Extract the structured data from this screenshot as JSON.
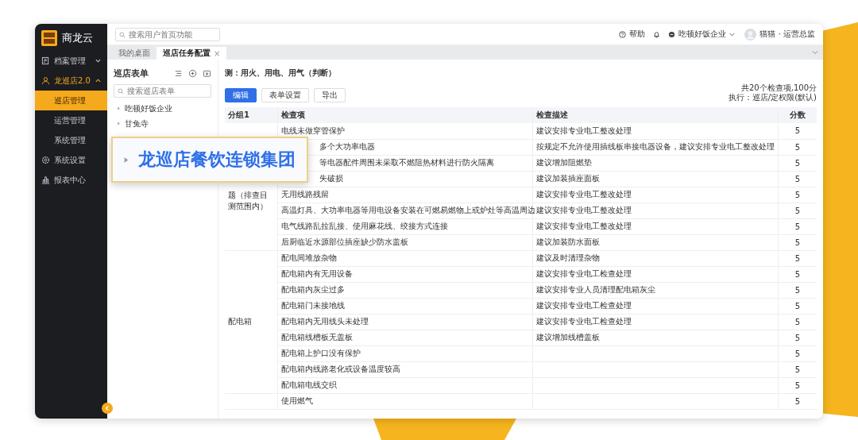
{
  "sidebar": {
    "brand": "商龙云",
    "items": [
      {
        "label": "档案管理",
        "kind": "group",
        "expanded": false
      },
      {
        "label": "龙巡店2.0",
        "kind": "group",
        "expanded": true,
        "children": [
          {
            "label": "巡店管理",
            "selected": true
          },
          {
            "label": "运营管理",
            "selected": false
          },
          {
            "label": "系统管理",
            "selected": false
          }
        ]
      },
      {
        "label": "系统设置",
        "kind": "link"
      },
      {
        "label": "报表中心",
        "kind": "link"
      }
    ]
  },
  "topbar": {
    "search_placeholder": "搜索用户首页功能",
    "help": "帮助",
    "company": "吃顿好饭企业",
    "user": "猫猫 · 运营总监"
  },
  "tabs": [
    {
      "label": "我的桌面",
      "selected": false
    },
    {
      "label": "巡店任务配置",
      "selected": true,
      "close": "×"
    }
  ],
  "left_panel": {
    "title": "巡店表单",
    "search_placeholder": "搜索巡店表单",
    "tree": [
      {
        "label": "吃顿好饭企业",
        "expanded": false
      },
      {
        "label": "甘兔寺",
        "expanded": false
      }
    ]
  },
  "callout": {
    "label": "龙巡店餐饮连锁集团"
  },
  "form": {
    "title": "测：用火、用电、用气（判断）",
    "buttons": [
      {
        "label": "编辑",
        "kind": "primary"
      },
      {
        "label": "表单设置",
        "kind": "default"
      },
      {
        "label": "导出",
        "kind": "default"
      }
    ],
    "summary": [
      "共20个检查项,100分",
      "执行：巡店/定权限(默认)"
    ],
    "table": {
      "columns": [
        "分组1",
        "检查项",
        "检查描述",
        "分数"
      ],
      "groups": [
        {
          "name": "题（排查目测范围内）",
          "rows": [
            {
              "item": "电线未做穿管保护",
              "description": "建议安排专业电工整改处理",
              "score": "5",
              "covered": false
            },
            {
              "item": "多个大功率电器",
              "description": "按规定不允许使用插线板串接电器设备，建议安排专业电工整改处理",
              "score": "5",
              "covered": true
            },
            {
              "item": "等电器配件周围未采取不燃阻热材料进行防火隔离",
              "description": "建议增加阻燃垫",
              "score": "5",
              "covered": true
            },
            {
              "item": "失破损",
              "description": "建议加装插座面板",
              "score": "5",
              "covered": true
            },
            {
              "item": "无用线路残留",
              "description": "建议安排专业电工整改处理",
              "score": "5",
              "covered": false
            },
            {
              "item": "高温灯具、大功率电器等用电设备安装在可燃易燃物上或炉灶等高温周边",
              "description": "建议安排专业电工整改处理",
              "score": "5",
              "covered": false
            },
            {
              "item": "电气线路乱拉乱接、使用麻花线、绞接方式连接",
              "description": "建议安排专业电工整改处理",
              "score": "5",
              "covered": false
            },
            {
              "item": "后厨临近水源部位插座缺少防水盖板",
              "description": "建议加装防水面板",
              "score": "5",
              "covered": false
            }
          ]
        },
        {
          "name": "配电箱",
          "rows": [
            {
              "item": "配电间堆放杂物",
              "description": "建议及时清理杂物",
              "score": "5",
              "covered": false
            },
            {
              "item": "配电箱内有无用设备",
              "description": "建议安排专业电工检查处理",
              "score": "5",
              "covered": false
            },
            {
              "item": "配电箱内灰尘过多",
              "description": "建议安排专业人员清理配电箱灰尘",
              "score": "5",
              "covered": false
            },
            {
              "item": "配电箱门未接地线",
              "description": "建议安排专业电工检查处理",
              "score": "5",
              "covered": false
            },
            {
              "item": "配电箱内无用线头未处理",
              "description": "建议安排专业电工检查处理",
              "score": "5",
              "covered": false
            },
            {
              "item": "配电箱线槽板无盖板",
              "description": "建议增加线槽盖板",
              "score": "5",
              "covered": false
            },
            {
              "item": "配电箱上护口没有保护",
              "score": "5",
              "covered": false
            },
            {
              "item": "配电箱内线路老化或设备温度较高",
              "score": "5",
              "covered": false
            },
            {
              "item": "配电箱电线交织",
              "score": "5",
              "covered": false
            }
          ]
        },
        {
          "rows": [
            {
              "item": "使用燃气",
              "score": "5",
              "covered": false
            }
          ]
        }
      ]
    }
  }
}
